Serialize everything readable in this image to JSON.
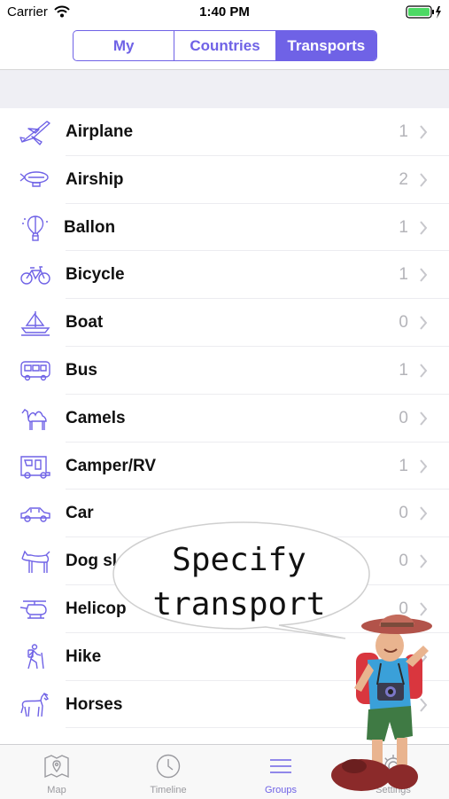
{
  "status_bar": {
    "carrier": "Carrier",
    "time": "1:40 PM"
  },
  "segments": [
    {
      "label": "My",
      "active": false
    },
    {
      "label": "Countries",
      "active": false
    },
    {
      "label": "Transports",
      "active": true
    }
  ],
  "rows": [
    {
      "label": "Airplane",
      "count": "1",
      "icon": "airplane-icon"
    },
    {
      "label": "Airship",
      "count": "2",
      "icon": "airship-icon"
    },
    {
      "label": "Ballon",
      "count": "1",
      "icon": "balloon-icon"
    },
    {
      "label": "Bicycle",
      "count": "1",
      "icon": "bicycle-icon"
    },
    {
      "label": "Boat",
      "count": "0",
      "icon": "boat-icon"
    },
    {
      "label": "Bus",
      "count": "1",
      "icon": "bus-icon"
    },
    {
      "label": "Camels",
      "count": "0",
      "icon": "camel-icon"
    },
    {
      "label": "Camper/RV",
      "count": "1",
      "icon": "camper-icon"
    },
    {
      "label": "Car",
      "count": "0",
      "icon": "car-icon"
    },
    {
      "label": "Dog sl",
      "count": "0",
      "icon": "dog-icon"
    },
    {
      "label": "Helicop",
      "count": "0",
      "icon": "helicopter-icon"
    },
    {
      "label": "Hike",
      "count": "",
      "icon": "hiker-icon"
    },
    {
      "label": "Horses",
      "count": "",
      "icon": "horse-icon"
    }
  ],
  "tabs": [
    {
      "label": "Map",
      "icon": "map-icon",
      "active": false
    },
    {
      "label": "Timeline",
      "icon": "clock-icon",
      "active": false
    },
    {
      "label": "Groups",
      "icon": "menu-icon",
      "active": true
    },
    {
      "label": "Settings",
      "icon": "gear-icon",
      "active": false
    }
  ],
  "overlay": {
    "line1": "Specify",
    "line2": "transport"
  },
  "colors": {
    "accent": "#6f62e6",
    "count_gray": "#b4b4b9",
    "section_bg": "#efeff4",
    "battery": "#4cd964"
  }
}
